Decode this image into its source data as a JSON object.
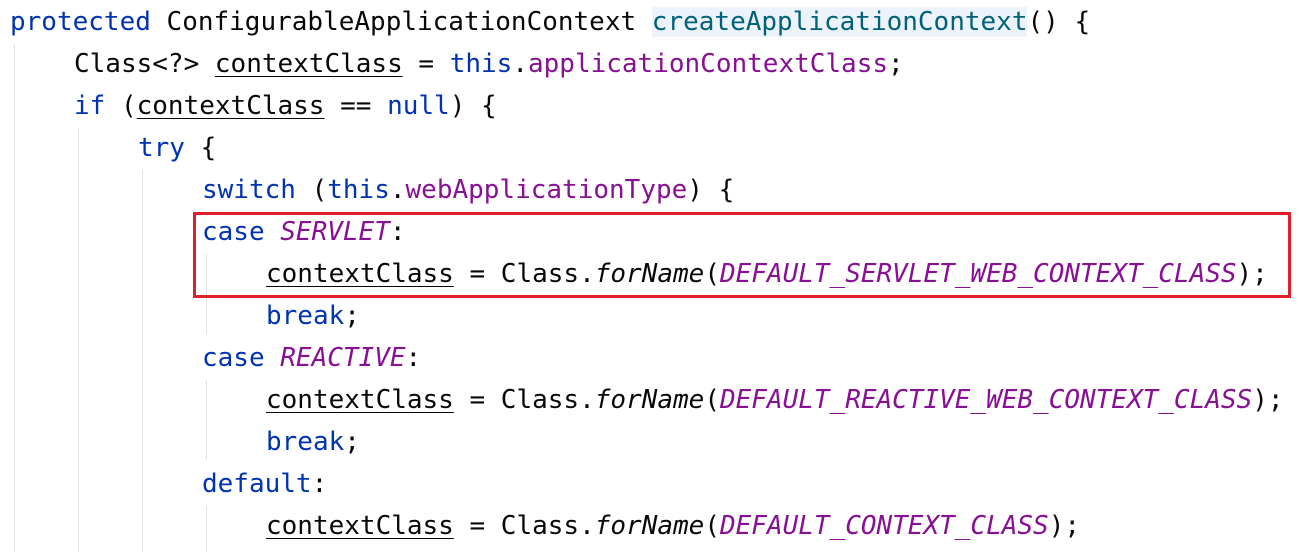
{
  "code": {
    "lines": [
      [
        [
          "protected",
          "kw"
        ],
        [
          " ConfigurableApplicationContext ",
          "plain"
        ],
        [
          "createApplicationContext",
          "method-decl"
        ],
        [
          "() {",
          "plain"
        ]
      ],
      [
        [
          "Class<?> ",
          "plain"
        ],
        [
          "contextClass",
          "local"
        ],
        [
          " = ",
          "plain"
        ],
        [
          "this",
          "kw"
        ],
        [
          ".",
          "plain"
        ],
        [
          "applicationContextClass",
          "field"
        ],
        [
          ";",
          "plain"
        ]
      ],
      [
        [
          "if",
          "kw"
        ],
        [
          " (",
          "plain"
        ],
        [
          "contextClass",
          "local"
        ],
        [
          " == ",
          "plain"
        ],
        [
          "null",
          "kw"
        ],
        [
          ") {",
          "plain"
        ]
      ],
      [
        [
          "try",
          "kw"
        ],
        [
          " {",
          "plain"
        ]
      ],
      [
        [
          "switch",
          "kw"
        ],
        [
          " (",
          "plain"
        ],
        [
          "this",
          "kw"
        ],
        [
          ".",
          "plain"
        ],
        [
          "webApplicationType",
          "field"
        ],
        [
          ") {",
          "plain"
        ]
      ],
      [
        [
          "case",
          "kw"
        ],
        [
          " ",
          "plain"
        ],
        [
          "SERVLET",
          "const"
        ],
        [
          ":",
          "plain"
        ]
      ],
      [
        [
          "contextClass",
          "local"
        ],
        [
          " = Class.",
          "plain"
        ],
        [
          "forName",
          "static-call"
        ],
        [
          "(",
          "plain"
        ],
        [
          "DEFAULT_SERVLET_WEB_CONTEXT_CLASS",
          "const"
        ],
        [
          ");",
          "plain"
        ]
      ],
      [
        [
          "break",
          "kw"
        ],
        [
          ";",
          "plain"
        ]
      ],
      [
        [
          "case",
          "kw"
        ],
        [
          " ",
          "plain"
        ],
        [
          "REACTIVE",
          "const"
        ],
        [
          ":",
          "plain"
        ]
      ],
      [
        [
          "contextClass",
          "local"
        ],
        [
          " = Class.",
          "plain"
        ],
        [
          "forName",
          "static-call"
        ],
        [
          "(",
          "plain"
        ],
        [
          "DEFAULT_REACTIVE_WEB_CONTEXT_CLASS",
          "const"
        ],
        [
          ");",
          "plain"
        ]
      ],
      [
        [
          "break",
          "kw"
        ],
        [
          ";",
          "plain"
        ]
      ],
      [
        [
          "default",
          "kw"
        ],
        [
          ":",
          "plain"
        ]
      ],
      [
        [
          "contextClass",
          "local"
        ],
        [
          " = Class.",
          "plain"
        ],
        [
          "forName",
          "static-call"
        ],
        [
          "(",
          "plain"
        ],
        [
          "DEFAULT_CONTEXT_CLASS",
          "const"
        ],
        [
          ");",
          "plain"
        ]
      ]
    ]
  },
  "colors": {
    "keyword": "#0033b3",
    "field": "#871094",
    "method_declaration": "#00627a",
    "highlight_border": "#e0202a"
  }
}
